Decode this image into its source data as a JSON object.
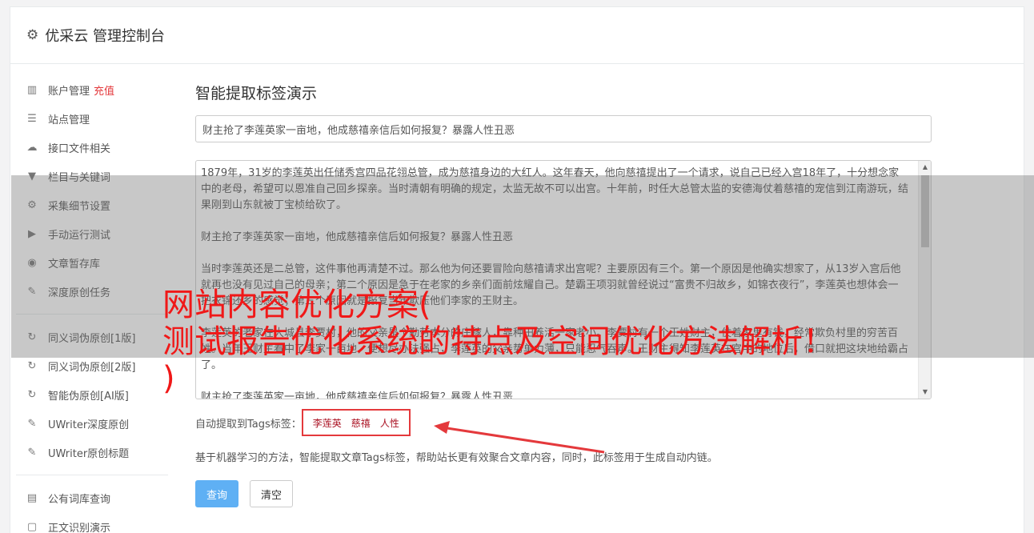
{
  "header": {
    "title": "优采云 管理控制台",
    "icon": "gear-icon"
  },
  "sidebar": {
    "group1": [
      {
        "label": "账户管理",
        "extra": "充值",
        "icon": "bar-chart-icon"
      },
      {
        "label": "站点管理",
        "icon": "server-icon"
      },
      {
        "label": "接口文件相关",
        "icon": "cloud-upload-icon"
      },
      {
        "label": "栏目与关键词",
        "icon": "filter-icon"
      },
      {
        "label": "采集细节设置",
        "icon": "cogs-icon"
      },
      {
        "label": "手动运行测试",
        "icon": "play-circle-icon"
      },
      {
        "label": "文章暂存库",
        "icon": "database-icon"
      },
      {
        "label": "深度原创任务",
        "icon": "edit-icon"
      }
    ],
    "group2": [
      {
        "label": "同义词伪原创[1版]",
        "icon": "refresh-icon"
      },
      {
        "label": "同义词伪原创[2版]",
        "icon": "refresh-icon"
      },
      {
        "label": "智能伪原创[AI版]",
        "icon": "refresh-icon"
      },
      {
        "label": "UWriter深度原创",
        "icon": "edit-icon"
      },
      {
        "label": "UWriter原创标题",
        "icon": "edit-icon"
      }
    ],
    "group3": [
      {
        "label": "公有词库查询",
        "icon": "book-icon"
      },
      {
        "label": "正文识别演示",
        "icon": "square-icon"
      }
    ]
  },
  "main": {
    "heading": "智能提取标签演示",
    "title_value": "财主抢了李莲英家一亩地，他成慈禧亲信后如何报复？暴露人性丑恶",
    "content": [
      "1879年，31岁的李莲英出任储秀宫四品花翎总管，成为慈禧身边的大红人。这年春天，他向慈禧提出了一个请求，说自己已经入宫18年了，十分想念家中的老母，希望可以恩准自己回乡探亲。当时清朝有明确的规定，太监无故不可以出宫。十年前，时任大总管太监的安德海仗着慈禧的宠信到江南游玩，结果刚到山东就被丁宝桢给砍了。",
      "财主抢了李莲英家一亩地，他成慈禧亲信后如何报复？暴露人性丑恶",
      "当时李莲英还是二总管，这件事他再清楚不过。那么他为何还要冒险向慈禧请求出宫呢？主要原因有三个。第一个原因是他确实想家了，从13岁入宫后他就再也没有见过自己的母亲；第二个原因是急于在老家的乡亲们面前炫耀自己。楚霸王项羽就曾经说过“富贵不归故乡，如锦衣夜行”，李莲英也想体会一把衣锦还乡的感觉；第三个原因就是报复当年欺压他们李家的王财主。",
      "李莲英的老家在大城县李贾村，他的父亲是个勤劳本分的庄稼人，靠种田养活一家老小。李贾村有一个王姓财主，仗着家里有钱，经常欺负村里的穷苦百姓。当年王财主看中了李家一亩地，便想尽办法强占，李莲英的父亲势单力薄，只能忍气吞声。王财主得知李莲英在宫中的地位后，借口就把这块地给霸占了。",
      "财主抢了李莲英家一亩地，他成慈禧亲信后如何报复？暴露人性丑恶"
    ],
    "tags_label": "自动提取到Tags标签：",
    "tags": [
      "李莲英",
      "慈禧",
      "人性"
    ],
    "description": "基于机器学习的方法，智能提取文章Tags标签，帮助站长更有效聚合文章内容，同时，此标签用于生成自动内链。",
    "query_button": "查询",
    "clear_button": "清空"
  },
  "overlay": {
    "line1": "网站内容优化方案(",
    "line2": "测试报告优化系统的特点及空间优化方法解析！",
    "line3": ")"
  },
  "colors": {
    "accent": "#5fb0f4",
    "annotation_red": "#e4393c",
    "overlay_text": "#f01818"
  }
}
